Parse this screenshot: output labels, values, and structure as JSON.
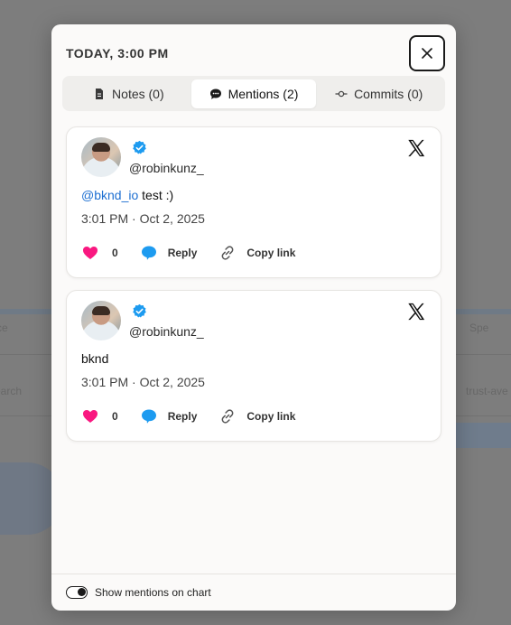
{
  "colors": {
    "accent_link": "#1d6fd1",
    "verified": "#1d9bf0",
    "like": "#f91880",
    "reply": "#1d9bf0",
    "overlay": "#7d7d7d"
  },
  "backdrop": {
    "left_label_1": "ce",
    "left_label_2": "earch",
    "right_label_1": "Spe",
    "right_label_2": "trust-ave"
  },
  "modal": {
    "title": "TODAY, 3:00 PM",
    "close_icon": "close-icon",
    "tabs": [
      {
        "label": "Notes (0)",
        "icon": "document-icon",
        "active": false
      },
      {
        "label": "Mentions (2)",
        "icon": "chat-bubble-icon",
        "active": true
      },
      {
        "label": "Commits (0)",
        "icon": "commit-icon",
        "active": false
      }
    ],
    "mentions": [
      {
        "handle": "@robinkunz_",
        "verified": true,
        "mention": "@bknd_io",
        "text": " test :)",
        "time": "3:01 PM · Oct 2, 2025",
        "likes": "0",
        "reply_label": "Reply",
        "copy_label": "Copy link"
      },
      {
        "handle": "@robinkunz_",
        "verified": true,
        "mention": "",
        "text": "bknd",
        "time": "3:01 PM · Oct 2, 2025",
        "likes": "0",
        "reply_label": "Reply",
        "copy_label": "Copy link"
      }
    ],
    "footer": {
      "toggle_label": "Show mentions on chart",
      "toggle_on": true
    }
  }
}
